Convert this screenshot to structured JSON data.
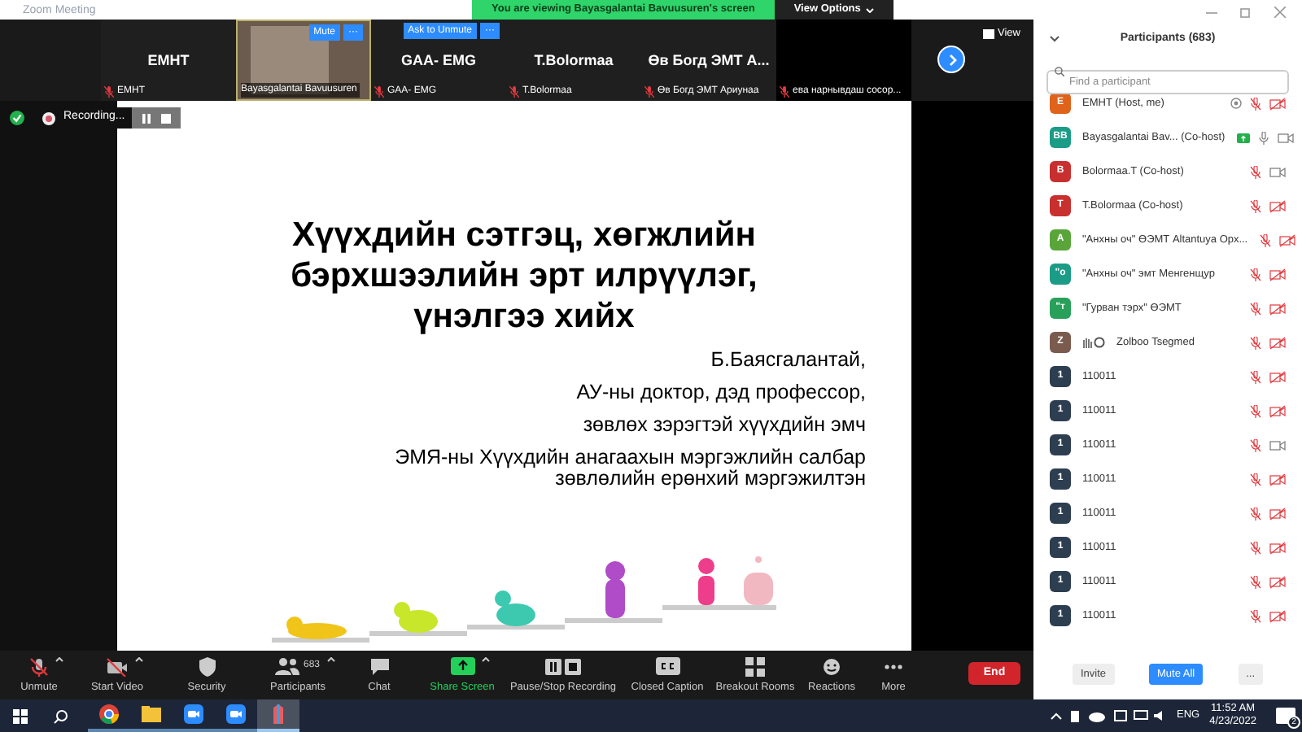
{
  "window": {
    "title": "Zoom Meeting"
  },
  "banner": {
    "text": "You are viewing Bayasgalantai Bavuusuren's screen",
    "view_options": "View Options"
  },
  "video_strip": {
    "tiles": [
      {
        "kind": "name",
        "name": "EMHT",
        "label": "EMHT"
      },
      {
        "kind": "video",
        "label": "Bayasgalantai Bavuusuren",
        "buttons": [
          "Mute",
          "···"
        ]
      },
      {
        "kind": "name",
        "name": "GAA- EMG",
        "label": "GAA- EMG",
        "buttons": [
          "Ask to Unmute",
          "···"
        ]
      },
      {
        "kind": "name",
        "name": "T.Bolormaa",
        "label": "T.Bolormaa"
      },
      {
        "kind": "name",
        "name": "Өв Богд ЭМТ А...",
        "label": "Өв Богд ЭМТ Ариунаа"
      },
      {
        "kind": "black",
        "label": "ева нарнывдаш сосор..."
      }
    ],
    "view": "View"
  },
  "recording": {
    "label": "Recording..."
  },
  "slide": {
    "title": "Хүүхдийн сэтгэц, хөгжлийн бэрхшээлийн эрт илрүүлэг, үнэлгээ хийх",
    "lines": [
      "Б.Баясгалантай,",
      "АУ-ны доктор, дэд профессор,",
      "зөвлөх зэрэгтэй хүүхдийн эмч",
      "ЭМЯ-ны Хүүхдийн анагаахын мэргэжлийн салбар зөвлөлийн ерөнхий мэргэжилтэн"
    ]
  },
  "toolbar": {
    "items": [
      {
        "kind": "mic",
        "label": "Unmute",
        "caret": true
      },
      {
        "kind": "video",
        "label": "Start Video",
        "caret": true
      },
      {
        "kind": "security",
        "label": "Security",
        "caret": false
      },
      {
        "kind": "participants",
        "label": "Participants",
        "count": "683",
        "caret": true
      },
      {
        "kind": "chat",
        "label": "Chat",
        "caret": false
      },
      {
        "kind": "share",
        "label": "Share Screen",
        "caret": true
      },
      {
        "kind": "recording",
        "label": "Pause/Stop Recording",
        "caret": false
      },
      {
        "kind": "cc",
        "label": "Closed Caption",
        "caret": false
      },
      {
        "kind": "breakout",
        "label": "Breakout Rooms",
        "caret": false
      },
      {
        "kind": "reactions",
        "label": "Reactions",
        "caret": false
      },
      {
        "kind": "more",
        "label": "More",
        "caret": false
      }
    ],
    "end": "End"
  },
  "participants": {
    "title": "Participants (683)",
    "search": {
      "placeholder": "Find a participant"
    },
    "items": [
      {
        "kind": "recording",
        "avatar": "E",
        "color": "#e0631c",
        "name": "EMHT (Host, me)",
        "mic_muted": true,
        "video_off": true
      },
      {
        "kind": "sharing",
        "avatar": "BB",
        "color": "#1a9c87",
        "name": "Bayasgalantai Bav... (Co-host)",
        "mic_muted": false,
        "video_off": false
      },
      {
        "kind": "plain",
        "avatar": "B",
        "color": "#c8302f",
        "name": "Bolormaa.T (Co-host)",
        "mic_muted": true,
        "video_off": false
      },
      {
        "kind": "plain",
        "avatar": "T",
        "color": "#c8302f",
        "name": "T.Bolormaa (Co-host)",
        "mic_muted": true,
        "video_off": true
      },
      {
        "kind": "plain",
        "avatar": "A",
        "color": "#5aa53a",
        "name": "\"Анхны оч\" ӨЭМТ Altantuya Орх...",
        "mic_muted": true,
        "video_off": true
      },
      {
        "kind": "plain",
        "avatar": "\"о",
        "color": "#1a9c87",
        "name": "\"Анхны оч\" эмт Менгенщур",
        "mic_muted": true,
        "video_off": true
      },
      {
        "kind": "plain",
        "avatar": "\"т",
        "color": "#28a05a",
        "name": "\"Гурван тэрх\" ӨЭМТ",
        "mic_muted": true,
        "video_off": true
      },
      {
        "kind": "hand",
        "avatar": "Z",
        "color": "#7a5b4e",
        "name": "Zolboo Tsegmed",
        "mic_muted": true,
        "video_off": true
      },
      {
        "kind": "plain",
        "avatar": "1",
        "color": "#2d3e50",
        "name": "110011",
        "mic_muted": true,
        "video_off": true
      },
      {
        "kind": "plain",
        "avatar": "1",
        "color": "#2d3e50",
        "name": "110011",
        "mic_muted": true,
        "video_off": true
      },
      {
        "kind": "plain",
        "avatar": "1",
        "color": "#2d3e50",
        "name": "110011",
        "mic_muted": true,
        "video_off": false
      },
      {
        "kind": "plain",
        "avatar": "1",
        "color": "#2d3e50",
        "name": "110011",
        "mic_muted": true,
        "video_off": true
      },
      {
        "kind": "plain",
        "avatar": "1",
        "color": "#2d3e50",
        "name": "110011",
        "mic_muted": true,
        "video_off": true
      },
      {
        "kind": "plain",
        "avatar": "1",
        "color": "#2d3e50",
        "name": "110011",
        "mic_muted": true,
        "video_off": true
      },
      {
        "kind": "plain",
        "avatar": "1",
        "color": "#2d3e50",
        "name": "110011",
        "mic_muted": true,
        "video_off": true
      },
      {
        "kind": "plain",
        "avatar": "1",
        "color": "#2d3e50",
        "name": "110011",
        "mic_muted": true,
        "video_off": true
      }
    ],
    "buttons": [
      "Invite",
      "Mute All",
      "..."
    ]
  },
  "taskbar": {
    "apps": [
      {
        "kind": "chrome",
        "selected": false
      },
      {
        "kind": "folder",
        "selected": false
      },
      {
        "kind": "zoom",
        "selected": false
      },
      {
        "kind": "zoom",
        "selected": false
      },
      {
        "kind": "app",
        "selected": true
      }
    ],
    "language": "ENG",
    "time": "11:52 AM",
    "date": "4/23/2022",
    "notifications": "2"
  }
}
